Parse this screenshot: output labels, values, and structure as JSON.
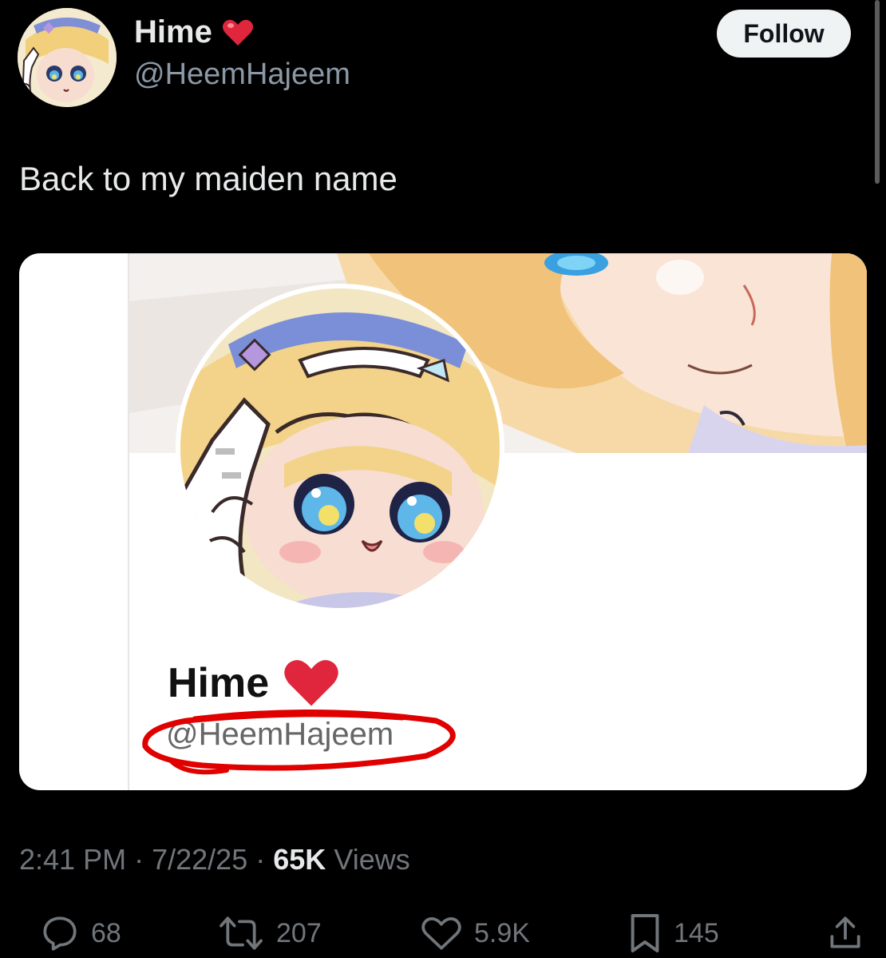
{
  "author": {
    "display_name": "Hime",
    "name_emoji": "heart-emoji",
    "handle": "@HeemHajeem"
  },
  "follow_button": {
    "label": "Follow"
  },
  "tweet": {
    "text": "Back to my maiden name"
  },
  "media_card": {
    "name": "Hime",
    "handle": "@HeemHajeem",
    "annotation": "red hand-drawn circle around handle",
    "colors": {
      "heart": "#e0263c",
      "annotation": "#e00000"
    }
  },
  "meta": {
    "time": "2:41 PM",
    "separator": "·",
    "date": "7/22/25",
    "views_count": "65K",
    "views_label": "Views"
  },
  "actions": [
    {
      "icon": "reply-icon",
      "count": "68"
    },
    {
      "icon": "retweet-icon",
      "count": "207"
    },
    {
      "icon": "like-icon",
      "count": "5.9K"
    },
    {
      "icon": "bookmark-icon",
      "count": "145"
    },
    {
      "icon": "share-icon"
    }
  ],
  "colors": {
    "background": "#000000",
    "primary_text": "#e7e9ea",
    "secondary_text": "#71767b",
    "follow_button_bg": "#eff3f4"
  }
}
